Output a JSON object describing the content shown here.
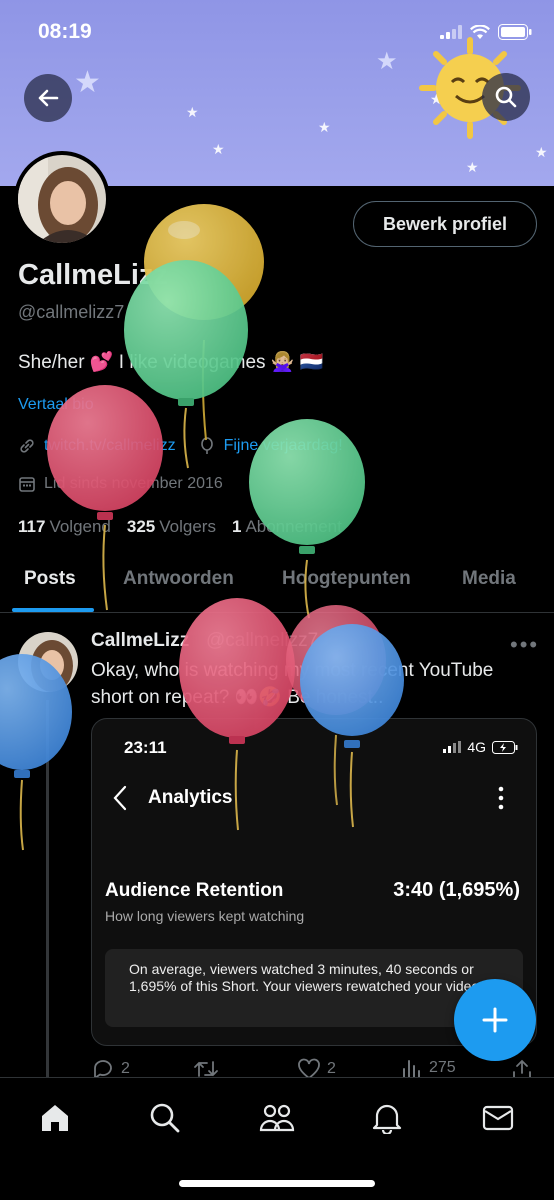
{
  "status_bar": {
    "time": "08:19"
  },
  "colors": {
    "accent": "#1d9bf0",
    "banner": "#9aa0ea",
    "text": "#e7e9ea",
    "muted": "#71767b"
  },
  "header": {
    "back_icon": "arrow-left-icon",
    "search_icon": "search-icon"
  },
  "profile": {
    "edit_button": "Bewerk profiel",
    "display_name": "CallmeLizz",
    "handle": "@callmelizz7",
    "bio": "She/her 💕 I like videogames 🙅🏼‍♀️ 🇳🇱",
    "translate_bio": "Vertaal bio",
    "website": "twitch.tv/callmelizz",
    "birthday": "Fijne verjaardag!",
    "joined": "Lid sinds november 2016",
    "following_count": "117",
    "following_label": "Volgend",
    "followers_count": "325",
    "followers_label": "Volgers",
    "subscriptions_count": "1",
    "subscriptions_label": "Abonnement"
  },
  "tabs": [
    {
      "label": "Posts"
    },
    {
      "label": "Antwoorden"
    },
    {
      "label": "Hoogtepunten"
    },
    {
      "label": "Media"
    }
  ],
  "post": {
    "author": "CallmeLizz",
    "handle": "@callmelizz7",
    "text": "Okay, who is watching my most recent YouTube short on repeat? 👀🤣 Be honest..",
    "media": {
      "time": "23:11",
      "network": "4G",
      "title": "Analytics",
      "retention_label": "Audience Retention",
      "retention_value": "3:40 (1,695%)",
      "retention_sub": "How long viewers kept watching",
      "info": "On average, viewers watched 3 minutes, 40 seconds or 1,695% of this Short. Your viewers rewatched your video!"
    },
    "replies": "2",
    "reposts": "",
    "likes": "2",
    "views": "275"
  },
  "bottom_nav": [
    "home-icon",
    "search-icon",
    "communities-icon",
    "bell-icon",
    "mail-icon"
  ]
}
